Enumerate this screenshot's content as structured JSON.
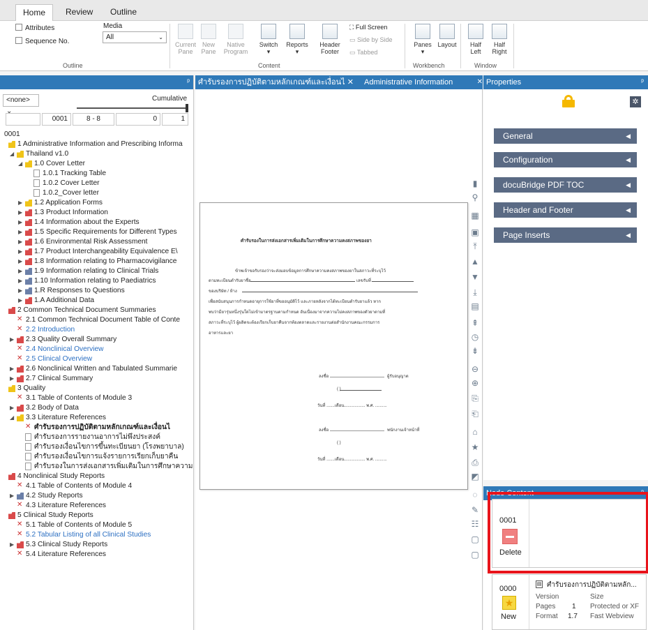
{
  "ribbon": {
    "tabs": [
      "Home",
      "Review",
      "Outline"
    ],
    "outline_group": {
      "attributes_label": "Attributes",
      "sequence_label": "Sequence No.",
      "media_label": "Media",
      "media_value": "All",
      "group_label": "Outline"
    },
    "content_group": {
      "current_pane": "Current\nPane",
      "new_pane": "New\nPane",
      "native_program": "Native\nProgram",
      "switch": "Switch",
      "reports": "Reports",
      "header_footer": "Header\nFooter",
      "full_screen": "Full Screen",
      "side_by_side": "Side by Side",
      "tabbed": "Tabbed",
      "group_label": "Content"
    },
    "workbench_group": {
      "panes": "Panes",
      "layout": "Layout",
      "group_label": "Workbench"
    },
    "window_group": {
      "half_left": "Half\nLeft",
      "half_right": "Half\nRight",
      "group_label": "Window"
    }
  },
  "outline_pane": {
    "filter_value": "<none>",
    "cumulative_label": "Cumulative",
    "seq": "0001",
    "range": "8 - 8",
    "n1": "0",
    "n2": "1",
    "tree": [
      {
        "level": 0,
        "icon": "none",
        "text": "0001",
        "tw": ""
      },
      {
        "level": 0,
        "icon": "folder-y",
        "text": "1 Administrative Information and Prescribing Informa",
        "tw": ""
      },
      {
        "level": 1,
        "icon": "folder-y",
        "text": "Thailand v1.0",
        "tw": "◢"
      },
      {
        "level": 2,
        "icon": "folder-y",
        "text": "1.0 Cover Letter",
        "tw": "◢"
      },
      {
        "level": 3,
        "icon": "doc",
        "text": "1.0.1 Tracking Table",
        "tw": ""
      },
      {
        "level": 3,
        "icon": "doc",
        "text": "1.0.2 Cover Letter",
        "tw": ""
      },
      {
        "level": 3,
        "icon": "doc",
        "text": "1.0.2_Cover letter",
        "tw": ""
      },
      {
        "level": 2,
        "icon": "folder-y",
        "text": "1.2 Application Forms",
        "tw": "▶"
      },
      {
        "level": 2,
        "icon": "folder-r",
        "text": "1.3 Product Information",
        "tw": "▶"
      },
      {
        "level": 2,
        "icon": "folder-r",
        "text": "1.4 Information about the Experts",
        "tw": "▶"
      },
      {
        "level": 2,
        "icon": "folder-r",
        "text": "1.5 Specific Requirements for Different Types",
        "tw": "▶"
      },
      {
        "level": 2,
        "icon": "folder-r",
        "text": "1.6 Environmental Risk Assessment",
        "tw": "▶"
      },
      {
        "level": 2,
        "icon": "folder-r",
        "text": "1.7 Product Interchangeability Equivalence E\\",
        "tw": "▶"
      },
      {
        "level": 2,
        "icon": "folder-r",
        "text": "1.8 Information relating to Pharmacovigilance",
        "tw": "▶"
      },
      {
        "level": 2,
        "icon": "folder-g",
        "text": "1.9 Information relating to Clinical Trials",
        "tw": "▶"
      },
      {
        "level": 2,
        "icon": "folder-g",
        "text": "1.10 Information relating to Paediatrics",
        "tw": "▶"
      },
      {
        "level": 2,
        "icon": "folder-g",
        "text": "1.R Responses to Questions",
        "tw": "▶"
      },
      {
        "level": 2,
        "icon": "folder-r",
        "text": "1.A Additional Data",
        "tw": "▶"
      },
      {
        "level": 0,
        "icon": "folder-r",
        "text": "2 Common Technical Document Summaries",
        "tw": ""
      },
      {
        "level": 1,
        "icon": "xmark",
        "text": "2.1 Common Technical Document Table of Conte",
        "tw": ""
      },
      {
        "level": 1,
        "icon": "xmark",
        "text": "2.2 Introduction",
        "tw": "",
        "link": true
      },
      {
        "level": 1,
        "icon": "folder-r",
        "text": "2.3 Quality Overall Summary",
        "tw": "▶"
      },
      {
        "level": 1,
        "icon": "xmark",
        "text": "2.4 Nonclinical Overview",
        "tw": "",
        "link": true
      },
      {
        "level": 1,
        "icon": "xmark",
        "text": "2.5 Clinical Overview",
        "tw": "",
        "link": true
      },
      {
        "level": 1,
        "icon": "folder-r",
        "text": "2.6 Nonclinical Written and Tabulated Summarie",
        "tw": "▶"
      },
      {
        "level": 1,
        "icon": "folder-r",
        "text": "2.7 Clinical Summary",
        "tw": "▶"
      },
      {
        "level": 0,
        "icon": "folder-y",
        "text": "3 Quality",
        "tw": ""
      },
      {
        "level": 1,
        "icon": "xmark",
        "text": "3.1 Table of Contents of Module 3",
        "tw": ""
      },
      {
        "level": 1,
        "icon": "folder-r",
        "text": "3.2 Body of Data",
        "tw": "▶"
      },
      {
        "level": 1,
        "icon": "folder-y",
        "text": "3.3 Literature References",
        "tw": "◢"
      },
      {
        "level": 2,
        "icon": "xmark",
        "text": "ศำรับรองการปฏิบัติตามหลักเกณฑ์และเงื่อนไ",
        "tw": "",
        "bold": true
      },
      {
        "level": 2,
        "icon": "doc",
        "text": "ศำรับรองการรายงานอาการไม่พึงประสงค์",
        "tw": ""
      },
      {
        "level": 2,
        "icon": "doc",
        "text": "ศำรับรองเงื่อนไขการขึ้นทะเบียนยา (โรงพยาบาล)",
        "tw": ""
      },
      {
        "level": 2,
        "icon": "doc",
        "text": "ศำรับรองเงื่อนไขการแจ้งรายการเรียกเก็บยาคืน",
        "tw": ""
      },
      {
        "level": 2,
        "icon": "doc",
        "text": "ศำรับรองในการส่งเอกสารเพิ่มเติมในการศึกษาความ",
        "tw": ""
      },
      {
        "level": 0,
        "icon": "folder-r",
        "text": "4 Nonclinical Study Reports",
        "tw": ""
      },
      {
        "level": 1,
        "icon": "xmark",
        "text": "4.1 Table of Contents of Module 4",
        "tw": ""
      },
      {
        "level": 1,
        "icon": "folder-g",
        "text": "4.2 Study Reports",
        "tw": "▶"
      },
      {
        "level": 1,
        "icon": "xmark",
        "text": "4.3 Literature References",
        "tw": ""
      },
      {
        "level": 0,
        "icon": "folder-r",
        "text": "5 Clinical Study Reports",
        "tw": ""
      },
      {
        "level": 1,
        "icon": "xmark",
        "text": "5.1 Table of Contents of Module 5",
        "tw": ""
      },
      {
        "level": 1,
        "icon": "xmark",
        "text": "5.2 Tabular Listing of all Clinical Studies",
        "tw": "",
        "link": true
      },
      {
        "level": 1,
        "icon": "folder-r",
        "text": "5.3 Clinical Study Reports",
        "tw": "▶"
      },
      {
        "level": 1,
        "icon": "xmark",
        "text": "5.4 Literature References",
        "tw": ""
      }
    ]
  },
  "document_pane": {
    "tab_title": "ศำรับรองการปฏิบัติตามหลักเกณฑ์และเงื่อนไ ✕",
    "tab2_title": "Administrative Information",
    "page": {
      "heading": "ศำรับรองในการส่งเอกสารเพิ่มเติมในการศึกษาความคงสภาพของยา",
      "para1": "ข้าพเจ้าขอรับรองว่าจะส่งมอบข้อมูลการศึกษาความคงสภาพของยาในสภาวะที่ระบุไว้",
      "line2": "ตามทะเบียนตำรับยาชื่อ",
      "line2b": "เลขรับที่",
      "line3": "ของบริษัท / ห้าง",
      "para2a": "เพื่อสนับสนุนการกำหนดอายุการใช้ยาที่ขออนุมัติไว้ และภายหลังจากได้ทะเบียนตำรับยาแล้ว หาก",
      "para2b": "พบว่ามียารุ่นหนึ่งรุ่นใดไม่เข้ามาตรฐานตามกำหนด อันเนื่องมาจากความไม่คงสภาพของตัวยาตามที่",
      "para2c": "สภาวะที่ระบุไว้ ผู้ผลิตจะต้องเรียกเก็บยาคืนจากท้องตลาดและรายงานต่อสำนักงานคณะกรรมการ",
      "para2d": "อาหารและยา",
      "sign1": "ลงชื่อ",
      "sign1b": "ผู้รับอนุญาต",
      "date1": "วันที่ .......เดือน.................. พ.ศ. ..........",
      "sign2": "ลงชื่อ",
      "sign2b": "พนักงานเจ้าหน้าที่",
      "date2": "วันที่ .......เดือน.................. พ.ศ. ..........",
      "paren": "(                              )"
    }
  },
  "properties": {
    "title": "Properties",
    "sections": [
      "General",
      "Configuration",
      "docuBridge PDF TOC",
      "Header and Footer",
      "Page Inserts"
    ]
  },
  "node_content": {
    "title": "Node Content",
    "cards": [
      {
        "seq": "0001",
        "action": "Delete"
      },
      {
        "seq": "0000",
        "action": "New",
        "doc_title": "ศำรับรองการปฏิบัติตามหลัก...",
        "version_label": "Version",
        "version_value": "",
        "size_label": "Size",
        "pages_label": "Pages",
        "pages_value": "1",
        "protected": "Protected or XF",
        "format_label": "Format",
        "format_value": "1.7",
        "fastweb": "Fast Webview"
      }
    ]
  },
  "colors": {
    "pane_header": "#2f79b8",
    "section_bar": "#5a6a84",
    "highlight": "#e8141b",
    "lock": "#f5b800"
  }
}
